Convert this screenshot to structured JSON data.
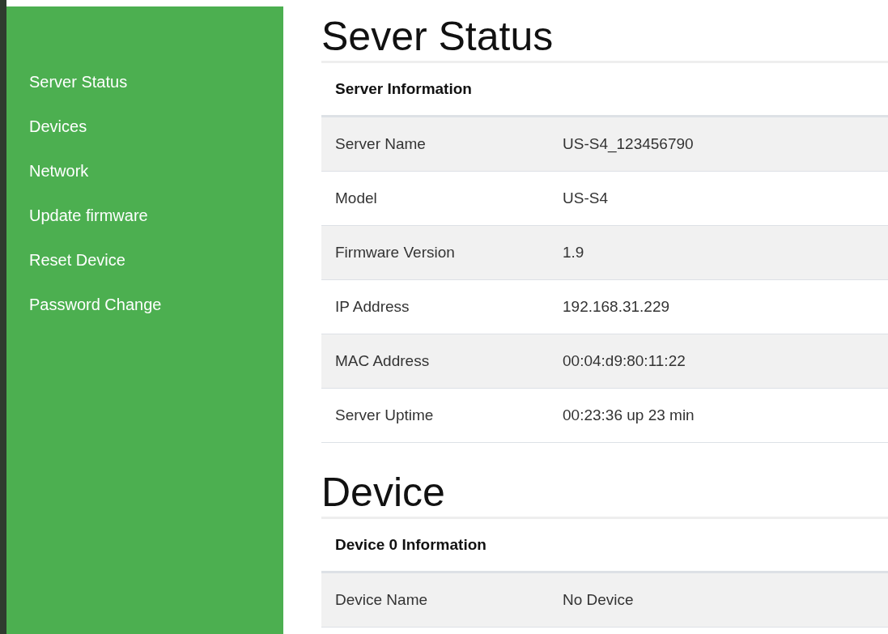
{
  "sidebar": {
    "items": [
      {
        "label": "Server Status"
      },
      {
        "label": "Devices"
      },
      {
        "label": "Network"
      },
      {
        "label": "Update firmware"
      },
      {
        "label": "Reset Device"
      },
      {
        "label": "Password Change"
      }
    ]
  },
  "sections": [
    {
      "title": "Sever Status",
      "table_heading": "Server Information",
      "rows": [
        {
          "label": "Server Name",
          "value": "US-S4_123456790"
        },
        {
          "label": "Model",
          "value": "US-S4"
        },
        {
          "label": "Firmware Version",
          "value": "1.9"
        },
        {
          "label": "IP Address",
          "value": "192.168.31.229"
        },
        {
          "label": "MAC Address",
          "value": "00:04:d9:80:11:22"
        },
        {
          "label": "Server Uptime",
          "value": "00:23:36 up 23 min"
        }
      ]
    },
    {
      "title": "Device",
      "table_heading": "Device 0 Information",
      "rows": [
        {
          "label": "Device Name",
          "value": "No Device"
        }
      ]
    }
  ]
}
